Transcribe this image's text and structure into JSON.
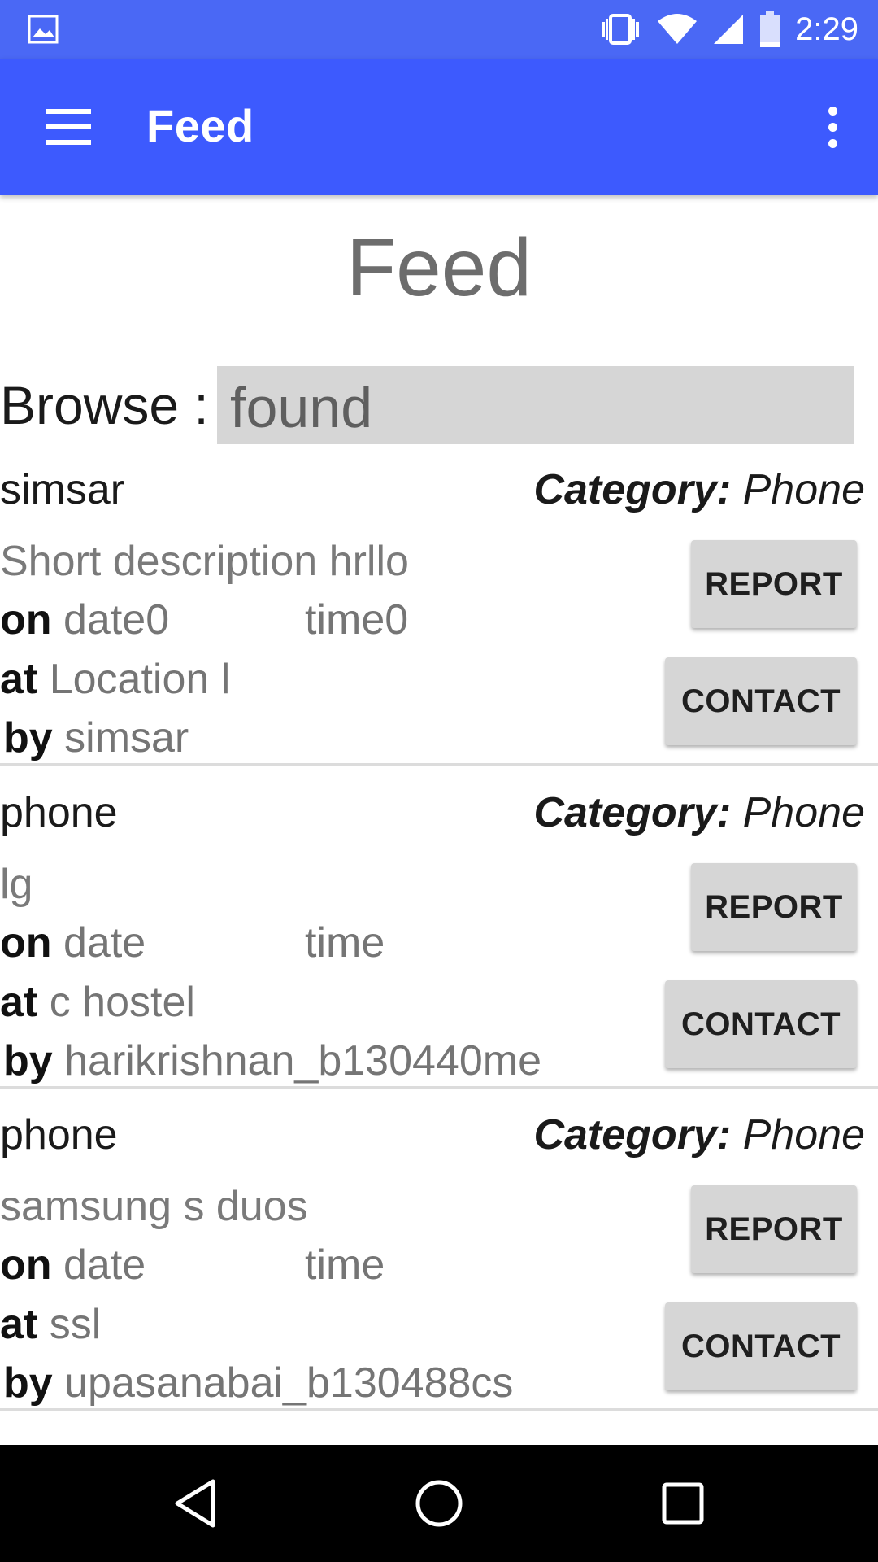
{
  "status_bar": {
    "time": "2:29",
    "icons": [
      "gallery-icon",
      "vibrate-icon",
      "wifi-icon",
      "signal-icon",
      "battery-icon"
    ]
  },
  "app_bar": {
    "title": "Feed",
    "background": "#3d5afe",
    "status_background": "#4a68f5"
  },
  "page": {
    "heading": "Feed",
    "browse_label": "Browse :",
    "browse_value": "found"
  },
  "labels": {
    "category": "Category:",
    "on": "on",
    "at": "at",
    "by": "by",
    "report": "REPORT",
    "contact": "CONTACT"
  },
  "items": [
    {
      "title": "simsar",
      "category": "Phone",
      "description": "Short description hrllo",
      "date": "date0",
      "time": "time0",
      "location": "Location l",
      "user": "simsar"
    },
    {
      "title": "phone",
      "category": "Phone",
      "description": "lg",
      "date": "date",
      "time": "time",
      "location": "c hostel",
      "user": "harikrishnan_b130440me"
    },
    {
      "title": "phone",
      "category": "Phone",
      "description": "samsung s duos",
      "date": "date",
      "time": "time",
      "location": "ssl",
      "user": "upasanabai_b130488cs"
    }
  ],
  "nav_bar": {
    "buttons": [
      "back-icon",
      "home-icon",
      "recents-icon"
    ]
  }
}
